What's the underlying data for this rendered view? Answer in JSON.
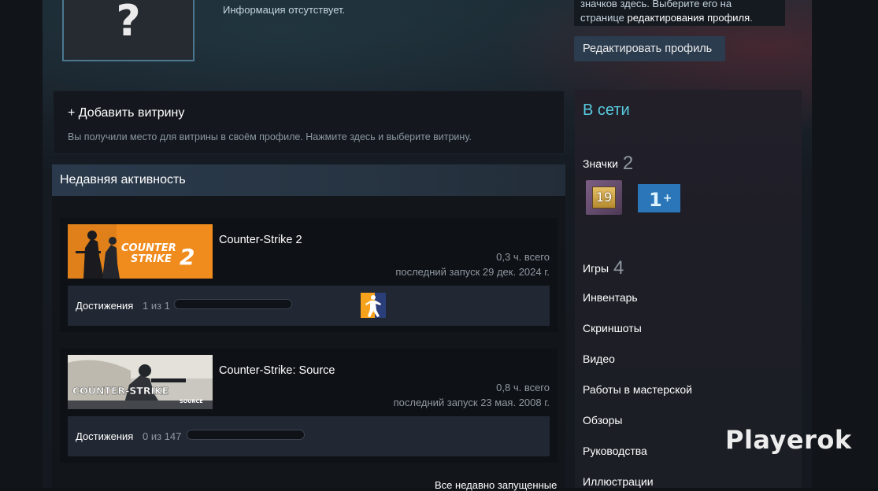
{
  "profile": {
    "avatar_glyph": "?",
    "info_absent": "Информация отсутствует."
  },
  "hint": {
    "line1": "значков здесь. Выберите его на",
    "line2_prefix": "странице ",
    "line2_link": "редактирования профиля",
    "line2_suffix": "."
  },
  "edit_profile_label": "Редактировать профиль",
  "showcase": {
    "title": "+ Добавить витрину",
    "description": "Вы получили место для витрины в своём профиле. Нажмите здесь и выберите витрину."
  },
  "recent": {
    "title": "Недавняя активность",
    "games": [
      {
        "name": "Counter-Strike 2",
        "hours": "0,3 ч. всего",
        "last_played": "последний запуск 29 дек. 2024 г.",
        "achievements_label": "Достижения",
        "achievements_count": "1 из 1",
        "progress": 0.0,
        "logo_line1": "COUNTER",
        "logo_line2": "STRIKE",
        "logo_num": "2"
      },
      {
        "name": "Counter-Strike: Source",
        "hours": "0,8 ч. всего",
        "last_played": "последний запуск 23 мая. 2008 г.",
        "achievements_label": "Достижения",
        "achievements_count": "0 из 147",
        "progress": 0.0,
        "logo_line1": "COUNTER-STRIKE",
        "logo_line2": "SOURCE"
      }
    ],
    "all_recent": "Все недавно запущенные"
  },
  "sidebar": {
    "status": "В сети",
    "badges_label": "Значки",
    "badges_count": "2",
    "badge_level": "19",
    "badge_years": "1",
    "badge_years_plus": "+",
    "games_label": "Игры",
    "games_count": "4",
    "links": [
      "Инвентарь",
      "Скриншоты",
      "Видео",
      "Работы в мастерской",
      "Обзоры",
      "Руководства",
      "Иллюстрации"
    ]
  },
  "watermark": "Playerok",
  "colors": {
    "online": "#57cbde",
    "cs2_orange": "#f08c1e",
    "badge_blue": "#2b76b8"
  }
}
